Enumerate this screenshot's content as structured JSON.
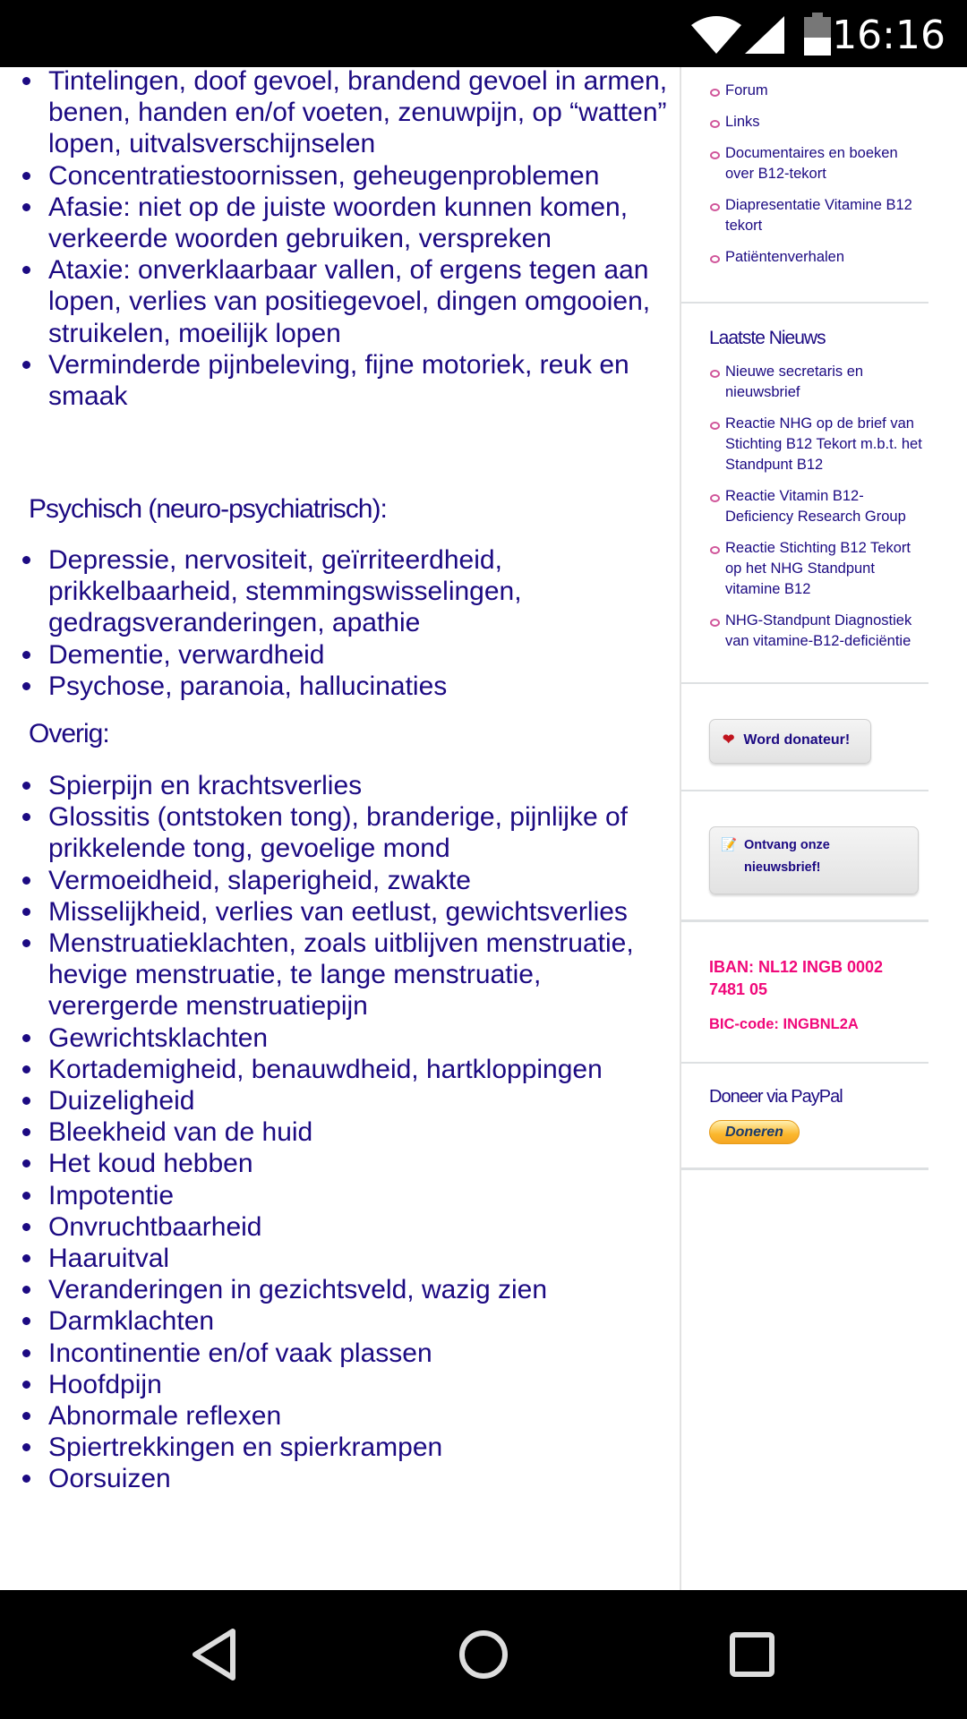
{
  "status_bar": {
    "time": "16:16",
    "icons": [
      "wifi-icon",
      "signal-icon",
      "battery-icon"
    ]
  },
  "main": {
    "list1": [
      "Tintelingen, doof gevoel, brandend gevoel in armen, benen, handen en/of voeten, zenuwpijn, op “watten” lopen, uitvalsverschijnselen",
      "Concentratiestoornissen, geheugenproblemen",
      "Afasie: niet op de juiste woorden kunnen komen, verkeerde woorden gebruiken, verspreken",
      "Ataxie: onverklaarbaar vallen, of ergens tegen aan lopen, verlies van positiegevoel, dingen omgooien, struikelen, moeilijk lopen",
      "Verminderde pijnbeleving, fijne motoriek, reuk en smaak"
    ],
    "heading2": "Psychisch (neuro-psychiatrisch):",
    "list2": [
      "Depressie, nervositeit, geïrriteerdheid, prikkelbaarheid, stemmingswisselingen, gedragsveranderingen, apathie",
      "Dementie, verwardheid",
      "Psychose, paranoia, hallucinaties"
    ],
    "heading3": "Overig:",
    "list3": [
      "Spierpijn en krachtsverlies",
      "Glossitis (ontstoken tong), branderige, pijnlijke of prikkelende tong, gevoelige mond",
      "Vermoeidheid, slaperigheid, zwakte",
      "Misselijkheid, verlies van eetlust, gewichtsverlies",
      "Menstruatieklachten, zoals uitblijven menstruatie, hevige menstruatie, te lange menstruatie, verergerde menstruatiepijn",
      "Gewrichtsklachten",
      "Kortademigheid, benauwdheid, hartkloppingen",
      "Duizeligheid",
      "Bleekheid van de huid",
      "Het koud hebben",
      "Impotentie",
      "Onvruchtbaarheid",
      "Haaruitval",
      "Veranderingen in gezichtsveld, wazig zien",
      "Darmklachten",
      "Incontinentie en/of vaak plassen",
      "Hoofdpijn",
      "Abnormale reflexen",
      "Spiertrekkingen en spierkrampen",
      "Oorsuizen"
    ]
  },
  "sidebar": {
    "menu": [
      "Forum",
      "Links",
      "Documentaires en boeken over B12-tekort",
      "Diapresentatie Vitamine B12 tekort",
      "Patiëntenverhalen"
    ],
    "news_title": "Laatste Nieuws",
    "news": [
      "Nieuwe secretaris en nieuwsbrief",
      "Reactie NHG op de brief van Stichting B12 Tekort m.b.t. het Standpunt B12",
      "Reactie Vitamin B12-Deficiency Research Group",
      "Reactie Stichting B12 Tekort op het NHG Standpunt vitamine B12",
      "NHG-Standpunt Diagnostiek van vitamine-B12-deficiëntie"
    ],
    "donate_button": "Word donateur!",
    "newsletter_button": "Ontvang onze nieuwsbrief!",
    "iban": "IBAN: NL12 INGB 0002 7481 05",
    "bic": "BIC-code: INGBNL2A",
    "paypal_title": "Doneer via PayPal",
    "paypal_button": "Doneren"
  },
  "colors": {
    "text": "#1c0a82",
    "accent_pink": "#f0087a",
    "bullet": "#d0569a"
  }
}
